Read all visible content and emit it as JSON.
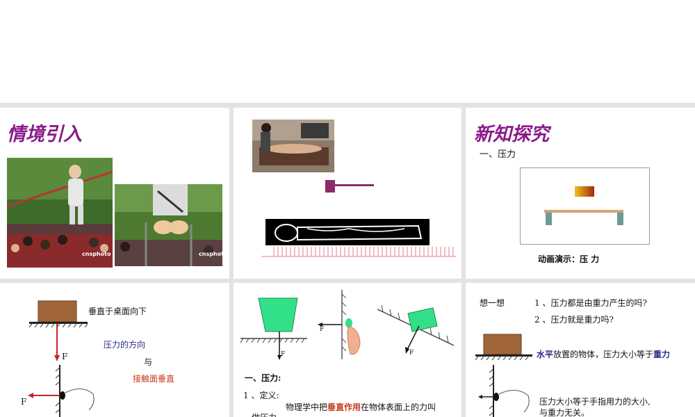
{
  "slide1": {
    "title": "情境引入",
    "watermark1": "cnsphoto",
    "watermark2": "cnsphoto"
  },
  "slide3": {
    "title": "新知探究",
    "section": "一、压力",
    "caption": "动画演示：压 力"
  },
  "slide4": {
    "vertical_text": "垂直于桌面向下",
    "direction_text": "压力的方向",
    "and_text": "与",
    "perp_text": "接触面垂直",
    "force_label_1": "F",
    "force_label_2": "F"
  },
  "slide5": {
    "force_label_1": "F",
    "force_label_2": "F",
    "force_label_3": "F",
    "section": "一、压力:",
    "def_label": "1 、定义:",
    "def_pre": "物理学中把",
    "def_red": "垂直作用",
    "def_post": "在物体表面上的力叫",
    "def_line2": "做压力"
  },
  "slide6": {
    "think": "想一想",
    "q1": "1 、压力都是由重力产生的吗?",
    "q2": "2 、压力就是重力吗?",
    "horizontal_word": "水平",
    "horizontal_mid": "放置的物体，压力大小等于",
    "gravity_word": "重力",
    "hand_line1": "压力大小等于手指用力的大小,",
    "hand_line2": "与重力无关。"
  },
  "colors": {
    "title_purple": "#8b1a8b",
    "red_text": "#c43a1a",
    "blue_text": "#2a2a8a",
    "green_block": "#33e08a",
    "brown_block": "#a0663a"
  }
}
